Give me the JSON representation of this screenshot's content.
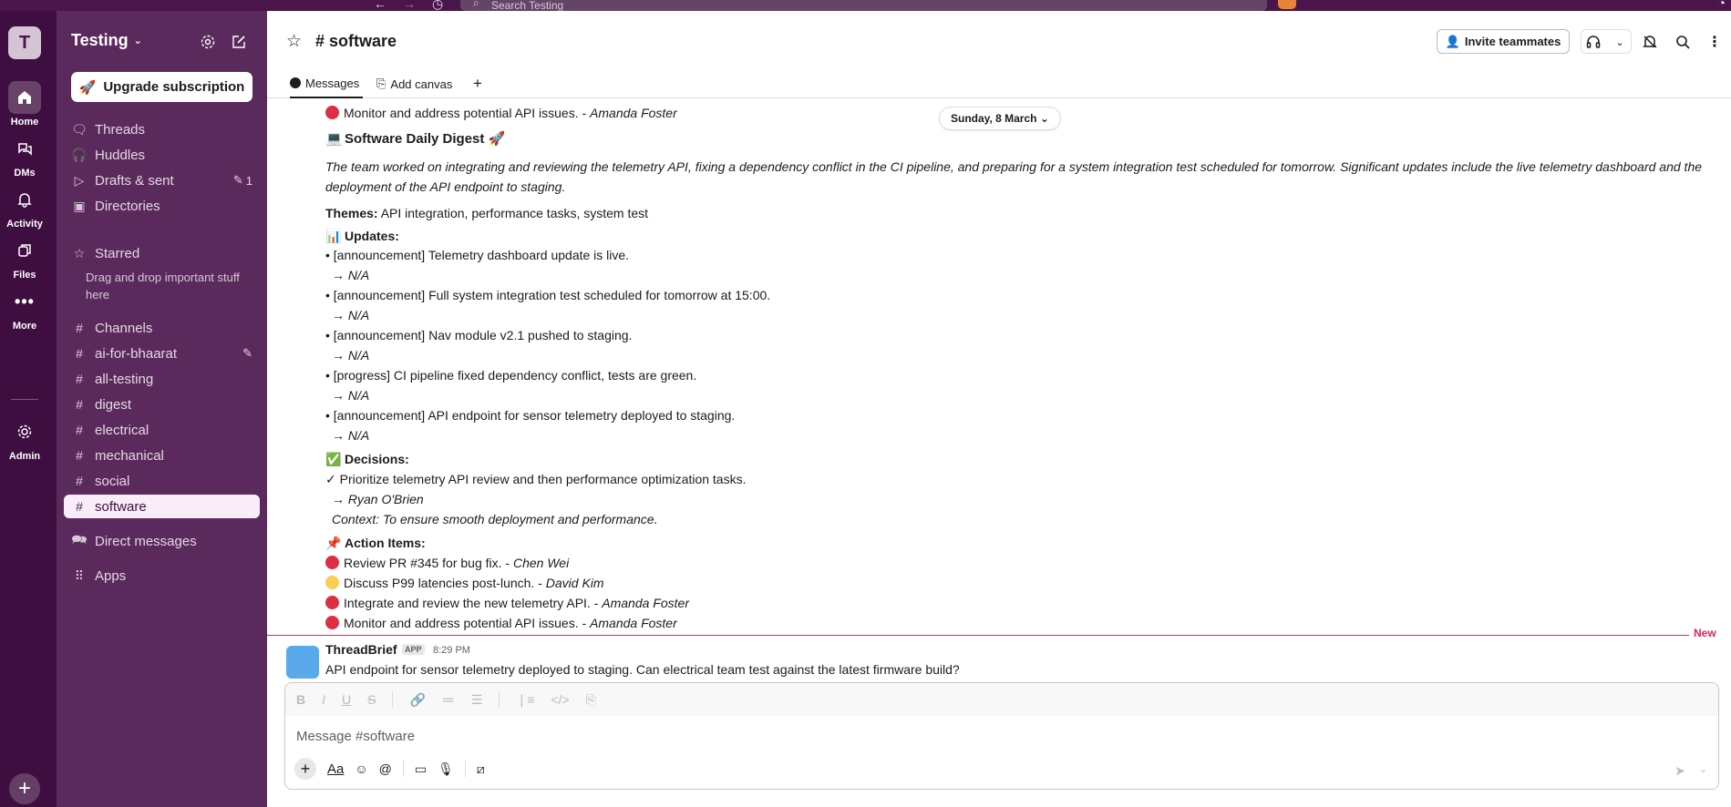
{
  "topbar": {
    "search_placeholder": "Search Testing"
  },
  "rail": {
    "workspace_initial": "T",
    "items": [
      {
        "label": "Home",
        "icon": "home-icon"
      },
      {
        "label": "DMs",
        "icon": "dms-icon"
      },
      {
        "label": "Activity",
        "icon": "bell-icon"
      },
      {
        "label": "Files",
        "icon": "files-icon"
      },
      {
        "label": "More",
        "icon": "more-icon"
      },
      {
        "label": "Admin",
        "icon": "gear-icon"
      }
    ]
  },
  "sidebar": {
    "workspace_name": "Testing",
    "upgrade_label": "Upgrade subscription",
    "nav": [
      {
        "label": "Threads"
      },
      {
        "label": "Huddles"
      },
      {
        "label": "Drafts & sent",
        "badge": "1"
      },
      {
        "label": "Directories"
      }
    ],
    "starred_label": "Starred",
    "starred_hint": "Drag and drop important stuff here",
    "channels_label": "Channels",
    "channels": [
      "ai-for-bhaarat",
      "all-testing",
      "digest",
      "electrical",
      "mechanical",
      "social",
      "software"
    ],
    "active_channel": "software",
    "direct_messages_label": "Direct messages",
    "apps_label": "Apps"
  },
  "header": {
    "channel_title": "# software",
    "invite_label": "Invite teammates"
  },
  "tabs": {
    "messages": "Messages",
    "add_canvas": "Add canvas",
    "add": "+"
  },
  "date_divider": "Sunday, 8 March",
  "messages": {
    "top_item": {
      "text": "Monitor and address potential API issues. - ",
      "who": "Amanda Foster"
    },
    "digest_title": "Software Daily Digest 🚀",
    "summary": "The team worked on integrating and reviewing the telemetry API, fixing a dependency conflict in the CI pipeline, and preparing for a system integration test scheduled for tomorrow. Significant updates include the live telemetry dashboard and the deployment of the API endpoint to staging.",
    "themes_label": "Themes:",
    "themes_value": "API integration, performance tasks, system test",
    "updates_label": "Updates:",
    "updates": [
      {
        "text": "• [announcement] Telemetry dashboard update is live.",
        "sub": "→ N/A"
      },
      {
        "text": "• [announcement] Full system integration test scheduled for tomorrow at 15:00.",
        "sub": "→ N/A"
      },
      {
        "text": "• [announcement] Nav module v2.1 pushed to staging.",
        "sub": "→ N/A"
      },
      {
        "text": "• [progress] CI pipeline fixed dependency conflict, tests are green.",
        "sub": "→ N/A"
      },
      {
        "text": "• [announcement] API endpoint for sensor telemetry deployed to staging.",
        "sub": "→ N/A"
      }
    ],
    "decisions_label": "Decisions:",
    "decision_text": "✓ Prioritize telemetry API review and then performance optimization tasks.",
    "decision_owner": "→ Ryan O'Brien",
    "decision_context": "Context: To ensure smooth deployment and performance.",
    "action_label": "Action Items:",
    "actions": [
      {
        "color": "red",
        "text": "Review PR #345 for bug fix. - ",
        "who": "Chen Wei"
      },
      {
        "color": "yellow",
        "text": "Discuss P99 latencies post-lunch. - ",
        "who": "David Kim"
      },
      {
        "color": "red",
        "text": "Integrate and review the new telemetry API. - ",
        "who": "Amanda Foster"
      },
      {
        "color": "red",
        "text": "Monitor and address potential API issues. - ",
        "who": "Amanda Foster"
      }
    ],
    "new_label": "New",
    "latest": {
      "author": "ThreadBrief",
      "badge": "APP",
      "time": "8:29 PM",
      "text": "API endpoint for sensor telemetry deployed to staging. Can electrical team test against the latest firmware build?"
    }
  },
  "composer": {
    "placeholder": "Message #software",
    "format_button": "Aa"
  },
  "colors": {
    "rail_bg": "#3f0e40",
    "sidebar_bg": "#5b2a5c",
    "accent_new": "#e01e5a"
  }
}
